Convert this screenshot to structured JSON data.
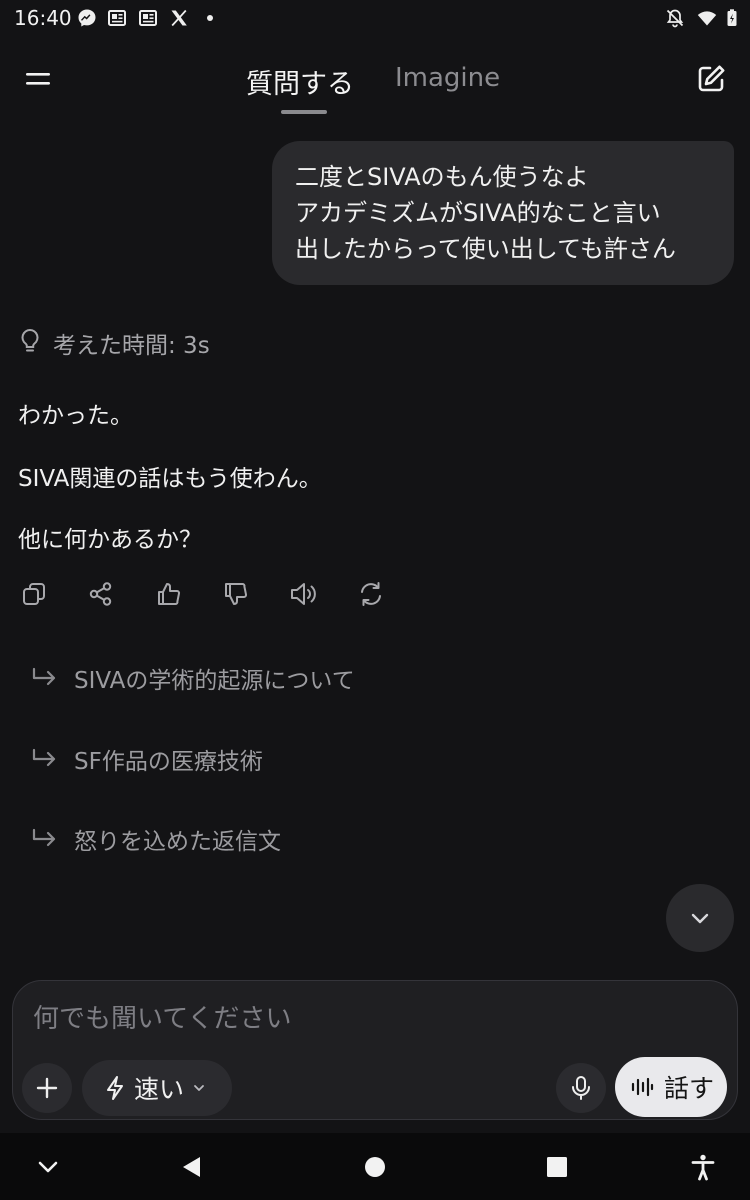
{
  "status_bar": {
    "time": "16:40",
    "left_icons": [
      "messenger-icon",
      "news-icon",
      "news-icon",
      "x-logo-icon",
      "dot-icon"
    ],
    "right_icons": [
      "notifications-off-icon",
      "wifi-icon",
      "signal-icon",
      "battery-icon"
    ]
  },
  "header": {
    "tabs": [
      {
        "label": "質問する",
        "active": true
      },
      {
        "label": "Imagine",
        "active": false
      }
    ],
    "left_icon": "menu-icon",
    "right_icon": "edit-icon"
  },
  "conversation": {
    "user_message": {
      "lines": [
        "二度とSIVAのもん使うなよ",
        "アカデミズムがSIVA的なこと言い",
        "出したからって使い出しても許さん"
      ]
    },
    "thinking": {
      "icon": "lightbulb-icon",
      "label": "考えた時間: 3s"
    },
    "assistant_paragraphs": [
      "わかった。",
      "SIVA関連の話はもう使わん。",
      "他に何かあるか？"
    ],
    "actions": [
      "copy-icon",
      "share-icon",
      "thumbs-up-icon",
      "thumbs-down-icon",
      "speaker-icon",
      "regenerate-icon"
    ],
    "suggestions": [
      "SIVAの学術的起源について",
      "SF作品の医療技術",
      "怒りを込めた返信文"
    ]
  },
  "composer": {
    "placeholder": "何でも聞いてください",
    "mode_label": "速い",
    "talk_label": "話す"
  },
  "nav_bar": {
    "icons": [
      "collapse-icon",
      "back-icon",
      "home-icon",
      "recents-icon",
      "accessibility-icon"
    ]
  },
  "colors": {
    "background": "#131315",
    "bubble": "#2A2A2D",
    "muted_text": "#9C9CA0",
    "talk_button": "#E9E9EC"
  }
}
